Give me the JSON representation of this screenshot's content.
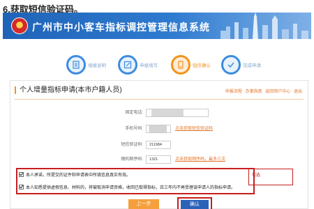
{
  "caption": "6.获取短信验证码。",
  "banner": {
    "title": "广州市中小客车指标调控管理信息系统"
  },
  "progress": {
    "steps": [
      {
        "label": "填报说明",
        "icon": "document-list-icon",
        "state": "done"
      },
      {
        "label": "申报填写",
        "icon": "edit-icon",
        "state": "done"
      },
      {
        "label": "短信确认",
        "icon": "sms-icon",
        "state": "active"
      },
      {
        "label": "完成申请",
        "icon": "check-icon",
        "state": "pending"
      }
    ],
    "colors": {
      "done": "#3c8ce0",
      "active": "#f2941d"
    }
  },
  "panel": {
    "title": "个人增量指标申请(本市户籍人员)",
    "links": [
      "申报流程",
      "办事指南",
      "返回用户中心",
      "退出"
    ]
  },
  "form": {
    "fixed_phone_label": "固定电话:",
    "mobile_label": "手机号码:",
    "get_sms_link": "点击获取短信验证码",
    "sms_code_label": "短信验证码:",
    "sms_code_value": "211984",
    "random_code_label": "随机顺序码:",
    "random_code_value": "1321",
    "get_random_link": "点击获取顺序码，最多三次"
  },
  "agreements": [
    "本人承诺，所提交的证件和申请表中所填信息真实有效。",
    "本人知悉提供虚假信息、材料的，将被取消申请资格，收回已取得指标，且三年内不再受理该申请人的指标申请。"
  ],
  "annotation": "勾选",
  "buttons": {
    "prev": "上一步",
    "confirm": "确认"
  }
}
